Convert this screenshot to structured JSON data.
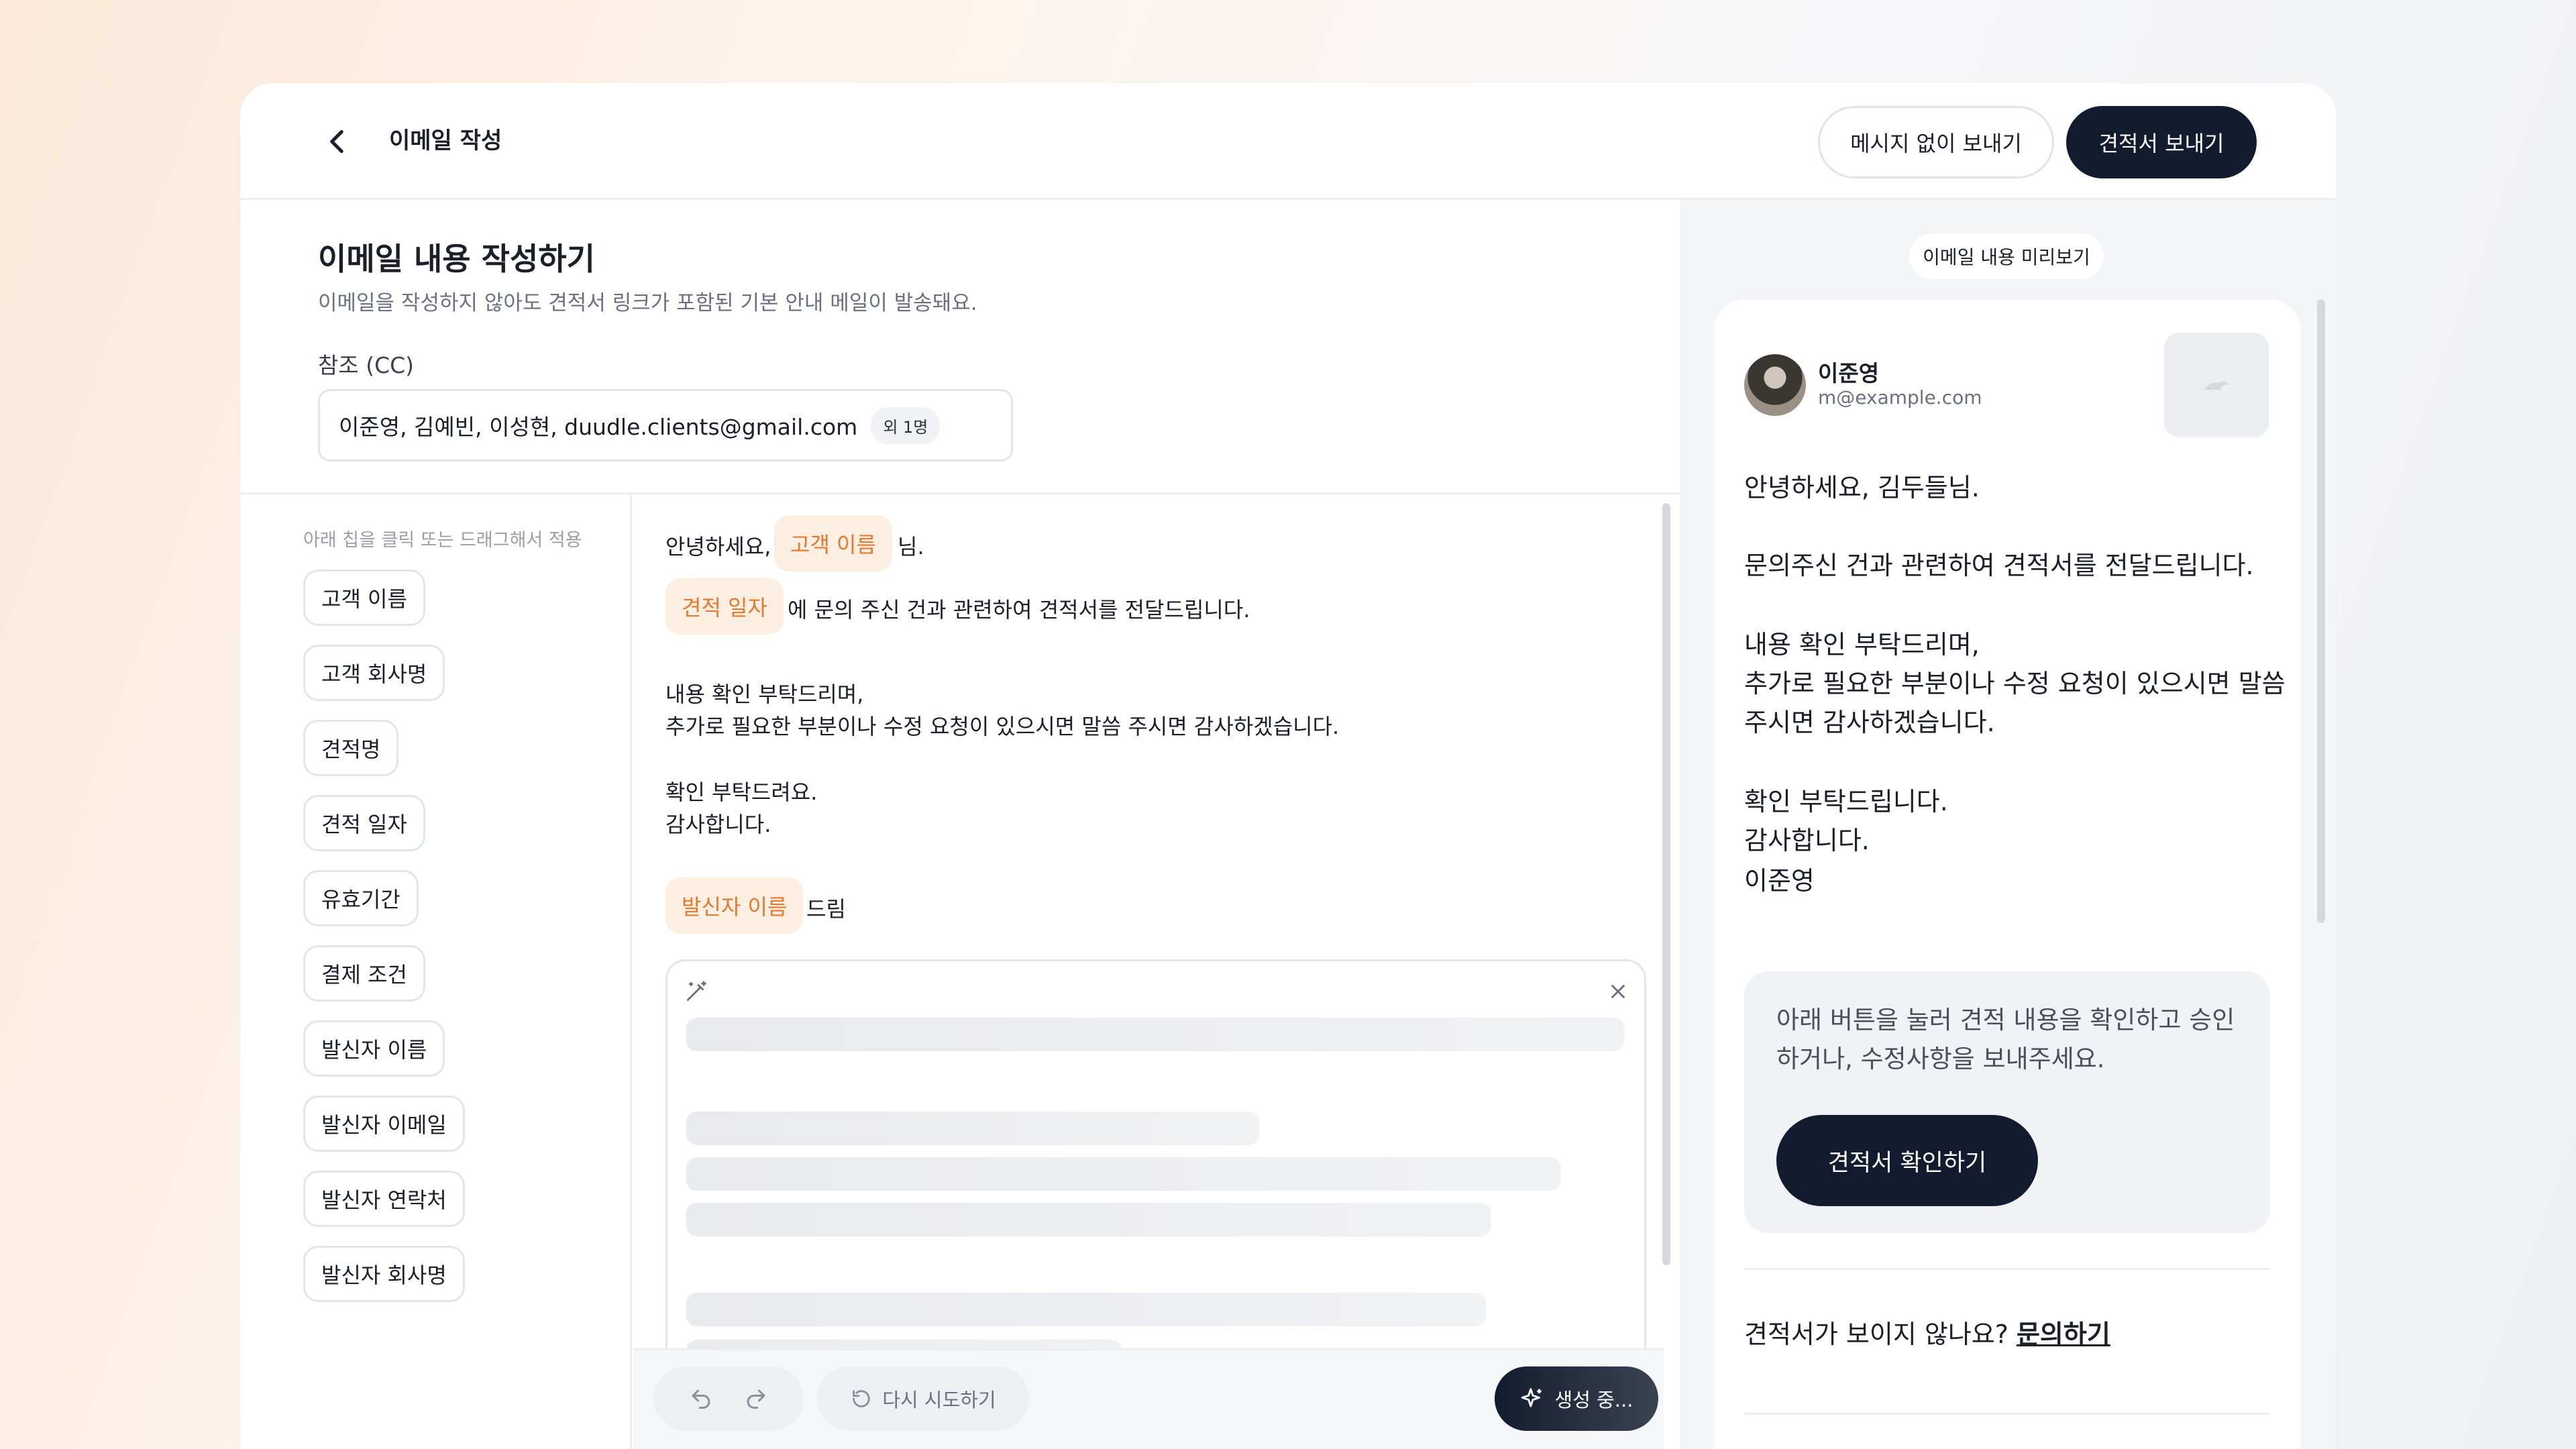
{
  "header": {
    "title": "이메일 작성",
    "send_without_message": "메시지 없이 보내기",
    "send_quote": "견적서 보내기"
  },
  "compose": {
    "title": "이메일 내용 작성하기",
    "subtitle": "이메일을 작성하지 않아도 견적서 링크가 포함된 기본 안내 메일이 발송돼요.",
    "cc_label": "참조 (CC)",
    "cc_value": "이준영, 김예빈, 이성현, duudle.clients@gmail.com",
    "cc_more": "외 1명"
  },
  "chips": {
    "hint": "아래 칩을 클릭 또는 드래그해서 적용",
    "items": [
      "고객 이름",
      "고객 회사명",
      "견적명",
      "견적 일자",
      "유효기간",
      "결제 조건",
      "발신자 이름",
      "발신자 이메일",
      "발신자 연락처",
      "발신자 회사명"
    ]
  },
  "editor": {
    "greeting_prefix": "안녕하세요,",
    "token_customer": "고객 이름",
    "greeting_suffix": "님.",
    "token_date": "견적 일자",
    "line2": "에 문의 주신 건과 관련하여 견적서를 전달드립니다.",
    "para1_line1": "내용 확인 부탁드리며,",
    "para1_line2": "추가로 필요한 부분이나 수정 요청이 있으시면 말씀 주시면 감사하겠습니다.",
    "para2_line1": "확인 부탁드려요.",
    "para2_line2": "감사합니다.",
    "token_sender": "발신자 이름",
    "sign_suffix": "드림"
  },
  "footer": {
    "retry": "다시 시도하기",
    "generating": "생성 중..."
  },
  "preview": {
    "pill": "이메일 내용 미리보기",
    "sender_name": "이준영",
    "sender_email": "m@example.com",
    "greeting": "안녕하세요, 김두들님.",
    "line1": "문의주신 건과 관련하여 견적서를 전달드립니다.",
    "para1": "내용 확인 부탁드리며,\n추가로 필요한 부분이나 수정 요청이 있으시면 말씀\n주시면 감사하겠습니다.",
    "para2": "확인 부탁드립니다.\n감사합니다.",
    "signature": "이준영",
    "cta_text": "아래 버튼을 눌러 견적 내용을 확인하고 승인하거나, 수정사항을 보내주세요.",
    "cta_button": "견적서 확인하기",
    "footer_question": "견적서가 보이지 않나요?",
    "footer_link": "문의하기"
  },
  "colors": {
    "primary_dark": "#131c2e",
    "token_bg": "#fdeee2",
    "token_text": "#e57a2f"
  }
}
